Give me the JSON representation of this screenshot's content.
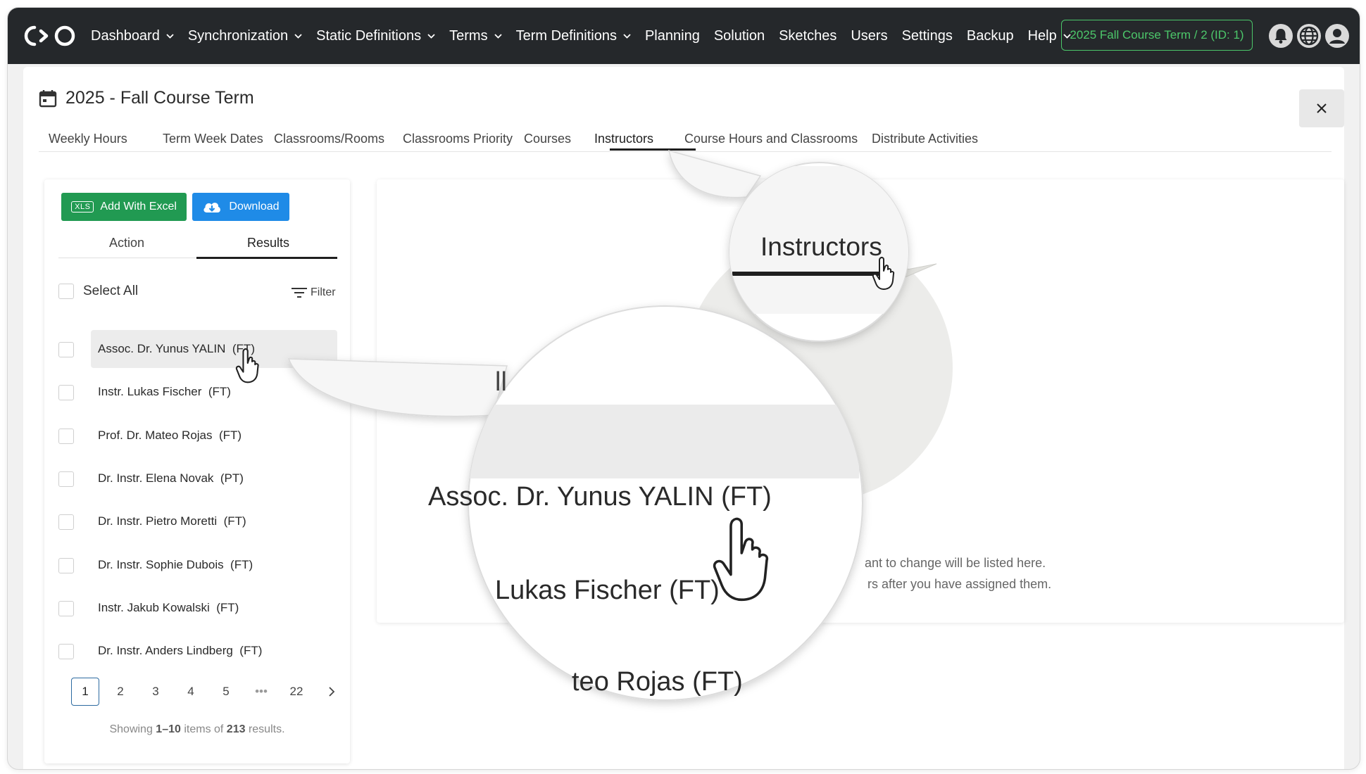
{
  "nav": {
    "items": [
      {
        "label": "Dashboard",
        "dropdown": true
      },
      {
        "label": "Synchronization",
        "dropdown": true
      },
      {
        "label": "Static Definitions",
        "dropdown": true
      },
      {
        "label": "Terms",
        "dropdown": true
      },
      {
        "label": "Term Definitions",
        "dropdown": true
      },
      {
        "label": "Planning",
        "dropdown": false
      },
      {
        "label": "Solution",
        "dropdown": false
      },
      {
        "label": "Sketches",
        "dropdown": false
      },
      {
        "label": "Users",
        "dropdown": false
      },
      {
        "label": "Settings",
        "dropdown": false
      },
      {
        "label": "Backup",
        "dropdown": false
      },
      {
        "label": "Help",
        "dropdown": true
      }
    ],
    "term_badge": "2025 Fall Course Term / 2 (ID: 1)",
    "icons": [
      "bell-icon",
      "globe-icon",
      "user-icon"
    ]
  },
  "page": {
    "title": "2025 - Fall Course Term",
    "tabs": [
      {
        "label": "Weekly Hours"
      },
      {
        "label": "Term Week Dates"
      },
      {
        "label": "Classrooms/Rooms"
      },
      {
        "label": "Classrooms Priority"
      },
      {
        "label": "Courses"
      },
      {
        "label": "Instructors"
      },
      {
        "label": "Course Hours and Classrooms"
      },
      {
        "label": "Distribute Activities"
      }
    ],
    "active_tab": "Instructors"
  },
  "left_panel": {
    "add_excel_label": "Add With Excel",
    "xls_badge": "XLS",
    "download_label": "Download",
    "subtabs": {
      "action": "Action",
      "results": "Results"
    },
    "select_all": "Select All",
    "filter": "Filter",
    "instructors": [
      {
        "name": "Assoc. Dr. Yunus YALIN",
        "type": "(FT)"
      },
      {
        "name": "Instr. Lukas Fischer",
        "type": "(FT)"
      },
      {
        "name": "Prof. Dr. Mateo Rojas",
        "type": "(FT)"
      },
      {
        "name": "Dr. Instr. Elena Novak",
        "type": "(PT)"
      },
      {
        "name": "Dr. Instr. Pietro Moretti",
        "type": "(FT)"
      },
      {
        "name": "Dr. Instr. Sophie Dubois",
        "type": "(FT)"
      },
      {
        "name": "Instr. Jakub Kowalski",
        "type": "(FT)"
      },
      {
        "name": "Dr. Instr. Anders Lindberg",
        "type": "(FT)"
      }
    ],
    "pagination": {
      "pages": [
        "1",
        "2",
        "3",
        "4",
        "5"
      ],
      "ellipsis": "•••",
      "last": "22",
      "current": "1"
    },
    "results": {
      "prefix": "Showing ",
      "range": "1–10",
      "middle": " items of ",
      "total": "213",
      "suffix": " results."
    }
  },
  "right_panel": {
    "line1": "ant to change will be listed here.",
    "line2": "rs after you have assigned them."
  },
  "magnifier": {
    "tab_label": "Instructors",
    "row1": "Assoc. Dr. Yunus YALIN  (FT)",
    "row2": "Lukas Fischer  (FT)",
    "row3": "teo Rojas  (FT)",
    "partial": "ll"
  },
  "colors": {
    "nav_bg": "#25282b",
    "badge_green": "#4cc76a",
    "excel_green": "#219a52",
    "download_blue": "#1f8be7",
    "pager_active": "#2c6aa0"
  }
}
